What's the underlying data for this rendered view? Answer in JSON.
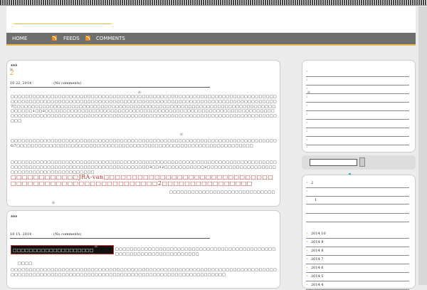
{
  "nav": {
    "home": "HOME",
    "feeds": "FEEDS",
    "comments": "COMMENTS"
  },
  "post1": {
    "title": "***",
    "number": "2",
    "date": "10   22, 2014 ·",
    "comments": "· (No comments)",
    "body_a": "□□□□□□□□□□□□□□□□□□□□□□□□□□□□□□□□□□□□□□□□□□□□□□□□□□□□□□□□□□□□□□□□□□□□□□□□□□□□□□□□□□□□□□□□□□□□□□□□□□□□□□□□□□□□□□□□□□□□□□□□□□□□□□□□□□□□□□□□□□□□□□□□□□7□□□□□□□□□□□□□□□□□□□□□□□□□□□□□□□□□□□□□□□□□□□□□□□□□□□□□□□□□□□□□□□□□□□□□□□□□□□□□□1□□2□□□□□□□□□□□□□□□□□□□□□□□□□□□□□□□□□□□□□□□□□□□□□□□□□□□□□□□□□□□□□□□□□□□□□□□□□□□□□□□□□□□□□□□□□□□□□□□□□□□□□□□□□□□□□□□□□□□□□□□□□□□□□□□□□□□□□□□□□□□",
    "body_b": "□□□□□□□□□□□□□□□□□□□□□□□□□□□□□□□□□□□□□□□□□□□□□□□□□□□□□□□□□□□□□□□□□□□□□□□□□G7□□□□□□□□□□□□□□□□□□□□□□□□□□□□□□□□□□□□□□□□□□□□□□□□□□□□□□□□□□□□□□□□□",
    "body_c": "□□□□□□□□□□□□□□□□□□□□□□□□□□□□□□□□□□□□□□□□□□□□□□□□□□□□□□□□□□□□□□□□□□□□□□□□□□□□□□□□□□□□□□□□□□□□□□□□□□□□□□□□□□□□□□□3□□12□□□□□□□□□□□2□□□□□□□□□□□□□□□□□□□□□□□□□□□□□□□□□□□□□□□□□□",
    "red": "□□□□□□□□□□□□JRA-van□□□□□□□□□□□□□□□□□□□□□□□□□□□□□□□□□□□□□□□□□□□□□□□□□□□□□□□□2□□□□□□□□□□□□□□□□",
    "body_d": "□□□□□□□□□□□□□□□□□□□□□□□□□□□□□□□□□□□□□"
  },
  "post2": {
    "title": "***",
    "date": "10   15, 2014 ·",
    "comments": "· (No comments)",
    "boxed": "□□□□□□□□□□□□□□□□□□□□",
    "body_a": "□□□□□□□□□□□□□□□□□□□□□□□□□□□□□□□□□□□□□□□□□□□□□□□□□□□□□□□□□□□□□□□□□□□",
    "body_b": "□□□□",
    "body_c": "□□□□□□□□□□□□□□□□□□□□□□□□□□□□□□□□□□□□□□□□□□□□□□□□□□□□□□□□□□□□□□□□□□□□□□□□□□□□□□□□□□□□□□□□□□□□□□□□□□□□□□□□□□□□□□□□□□□□□□□□□□□□□□□□□□□□"
  },
  "sidebar": {
    "top_rows": [
      "",
      "",
      "",
      "",
      "",
      "",
      "",
      "",
      "",
      ""
    ],
    "lower_rows": [
      {
        "label": "2",
        "dot": true
      },
      {
        "label": "",
        "dot": true
      },
      {
        "label": "1",
        "dot": false
      },
      {
        "label": "",
        "dot": false
      },
      {
        "label": "",
        "dot": false
      }
    ],
    "archive": [
      "2014   10",
      "2014   9",
      "2014   8",
      "2014   7",
      "2014   6",
      "2014   5",
      "2014   4"
    ]
  },
  "search": {
    "value": ""
  },
  "colors": {
    "accent": "#e8b84a",
    "nav": "#6e6e6e",
    "rss": "#f28a1a",
    "red_text": "#c0302a"
  }
}
